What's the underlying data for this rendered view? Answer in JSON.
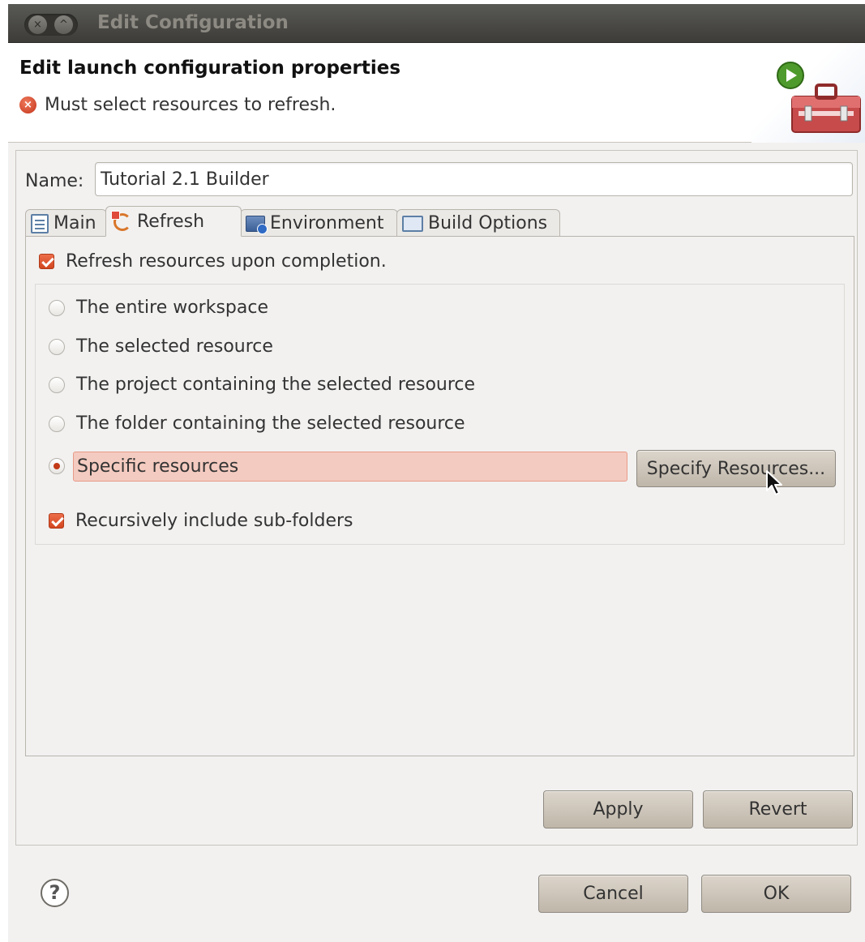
{
  "window": {
    "title": "Edit Configuration",
    "close_glyph": "×",
    "minimize_glyph": "^"
  },
  "header": {
    "title": "Edit launch configuration properties",
    "message": "Must select resources to refresh.",
    "error_glyph": "×",
    "banner_icon": "toolbox-run-icon"
  },
  "name_field": {
    "label": "Name:",
    "value": "Tutorial 2.1 Builder"
  },
  "tabs": [
    {
      "label": "Main",
      "icon": "document-icon",
      "active": false
    },
    {
      "label": "Refresh",
      "icon": "refresh-icon",
      "active": true
    },
    {
      "label": "Environment",
      "icon": "environment-icon",
      "active": false
    },
    {
      "label": "Build Options",
      "icon": "folder-icon",
      "active": false
    }
  ],
  "refresh": {
    "refresh_upon_completion_label": "Refresh resources upon completion.",
    "refresh_upon_completion_checked": true,
    "options": [
      {
        "label": "The entire workspace",
        "selected": false
      },
      {
        "label": "The selected resource",
        "selected": false
      },
      {
        "label": "The project containing the selected resource",
        "selected": false
      },
      {
        "label": "The folder containing the selected resource",
        "selected": false
      },
      {
        "label": "Specific resources",
        "selected": true
      }
    ],
    "specify_button": "Specify Resources...",
    "recursive_label": "Recursively include sub-folders",
    "recursive_checked": true
  },
  "buttons": {
    "apply": "Apply",
    "revert": "Revert",
    "cancel": "Cancel",
    "ok": "OK",
    "help": "?"
  },
  "colors": {
    "accent": "#d2461f",
    "error_highlight": "#f4cbc0",
    "titlebar": "#3d3c38"
  }
}
